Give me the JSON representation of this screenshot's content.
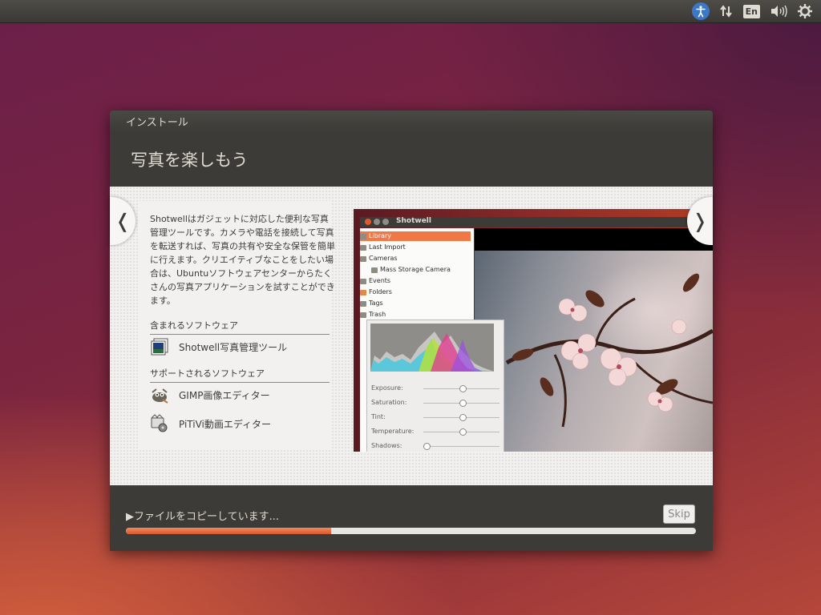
{
  "window": {
    "title": "インストール",
    "heading": "写真を楽しもう"
  },
  "slide": {
    "description": "Shotwellはガジェットに対応した便利な写真管理ツールです。カメラや電話を接続して写真を転送すれば、写真の共有や安全な保管を簡単に行えます。クリエイティブなことをしたい場合は、Ubuntuソフトウェアセンターからたくさんの写真アプリケーションを試すことができます。",
    "included_heading": "含まれるソフトウェア",
    "included_apps": [
      {
        "name": "Shotwell写真管理ツール",
        "icon": "shotwell-icon"
      }
    ],
    "supported_heading": "サポートされるソフトウェア",
    "supported_apps": [
      {
        "name": "GIMP画像エディター",
        "icon": "gimp-icon"
      },
      {
        "name": "PiTiVi動画エディター",
        "icon": "pitivi-icon"
      }
    ]
  },
  "screenshot": {
    "app_title": "Shotwell",
    "sidebar": [
      "Library",
      "Last Import",
      "Cameras",
      "Mass Storage Camera",
      "Events",
      "Folders",
      "Tags",
      "Trash"
    ],
    "adjustments": [
      {
        "label": "Exposure:",
        "level": 0.5
      },
      {
        "label": "Saturation:",
        "level": 0.5
      },
      {
        "label": "Tint:",
        "level": 0.5
      },
      {
        "label": "Temperature:",
        "level": 0.5
      },
      {
        "label": "Shadows:",
        "level": 0.0
      }
    ]
  },
  "footer": {
    "status": "ファイルをコピーしています...",
    "skip_label": "Skip",
    "progress": 0.36
  },
  "topbar": {
    "language": "En"
  },
  "colors": {
    "accent": "#dd4814",
    "panel": "#3c3b37"
  }
}
